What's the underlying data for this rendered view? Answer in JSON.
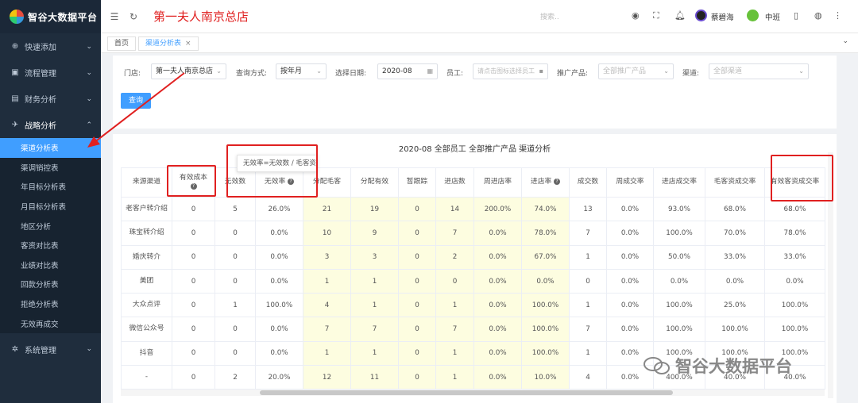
{
  "app": {
    "name": "智谷大数据平台"
  },
  "sidebar": {
    "items": [
      {
        "label": "快速添加",
        "icon": "plus-circle-icon"
      },
      {
        "label": "流程管理",
        "icon": "camera-icon"
      },
      {
        "label": "财务分析",
        "icon": "chart-icon"
      },
      {
        "label": "战略分析",
        "icon": "plane-icon"
      }
    ],
    "submenu": [
      {
        "label": "渠道分析表",
        "active": true
      },
      {
        "label": "渠调销控表"
      },
      {
        "label": "年目标分析表"
      },
      {
        "label": "月目标分析表"
      },
      {
        "label": "地区分析"
      },
      {
        "label": "客资对比表"
      },
      {
        "label": "业绩对比表"
      },
      {
        "label": "回款分析表"
      },
      {
        "label": "拒绝分析表"
      },
      {
        "label": "无效再成交"
      }
    ],
    "system": {
      "label": "系统管理",
      "icon": "gear-icon"
    }
  },
  "header": {
    "store_title": "第一夫人南京总店",
    "search_placeholder": "搜索..",
    "user1": "蔡碧海",
    "user2": "中班"
  },
  "tabs": [
    {
      "label": "首页"
    },
    {
      "label": "渠道分析表",
      "active": true,
      "close": "×"
    }
  ],
  "filter": {
    "store_label": "门店:",
    "store_value": "第一夫人南京总店",
    "query_mode_label": "查询方式:",
    "query_mode_value": "按年月",
    "date_label": "选择日期:",
    "date_value": "2020-08",
    "staff_label": "员工:",
    "staff_placeholder": "请点击图标选择员工",
    "product_label": "推广产品:",
    "product_placeholder": "全部推广产品",
    "channel_label": "渠道:",
    "channel_placeholder": "全部渠道",
    "query_button": "查询"
  },
  "table": {
    "title": "2020-08 全部员工 全部推广产品 渠道分析",
    "tooltip": "无效率=无效数 / 毛客资",
    "columns": [
      "来源渠道",
      "有效成本",
      "无效数",
      "无效率",
      "分配毛客",
      "分配有效",
      "暂跟踪",
      "进店数",
      "周进店率",
      "进店率",
      "成交数",
      "周成交率",
      "进店成交率",
      "毛客资成交率",
      "有效客资成交率"
    ],
    "rows": [
      [
        "老客户转介绍",
        "0",
        "5",
        "26.0%",
        "21",
        "19",
        "0",
        "14",
        "200.0%",
        "74.0%",
        "13",
        "0.0%",
        "93.0%",
        "68.0%",
        "68.0%"
      ],
      [
        "珠宝转介绍",
        "0",
        "0",
        "0.0%",
        "10",
        "9",
        "0",
        "7",
        "0.0%",
        "78.0%",
        "7",
        "0.0%",
        "100.0%",
        "70.0%",
        "78.0%"
      ],
      [
        "婚庆转介",
        "0",
        "0",
        "0.0%",
        "3",
        "3",
        "0",
        "2",
        "0.0%",
        "67.0%",
        "1",
        "0.0%",
        "50.0%",
        "33.0%",
        "33.0%"
      ],
      [
        "美团",
        "0",
        "0",
        "0.0%",
        "1",
        "1",
        "0",
        "0",
        "0.0%",
        "0.0%",
        "0",
        "0.0%",
        "0.0%",
        "0.0%",
        "0.0%"
      ],
      [
        "大众点评",
        "0",
        "1",
        "100.0%",
        "4",
        "1",
        "0",
        "1",
        "0.0%",
        "100.0%",
        "1",
        "0.0%",
        "100.0%",
        "25.0%",
        "100.0%"
      ],
      [
        "微信公众号",
        "0",
        "0",
        "0.0%",
        "7",
        "7",
        "0",
        "7",
        "0.0%",
        "100.0%",
        "7",
        "0.0%",
        "100.0%",
        "100.0%",
        "100.0%"
      ],
      [
        "抖音",
        "0",
        "0",
        "0.0%",
        "1",
        "1",
        "0",
        "1",
        "0.0%",
        "100.0%",
        "1",
        "0.0%",
        "100.0%",
        "100.0%",
        "100.0%"
      ],
      [
        "-",
        "0",
        "2",
        "20.0%",
        "12",
        "11",
        "0",
        "1",
        "0.0%",
        "10.0%",
        "4",
        "0.0%",
        "400.0%",
        "40.0%",
        "40.0%"
      ]
    ]
  },
  "watermark": "智谷大数据平台",
  "colors": {
    "sidebar_bg": "#1f2d3d",
    "accent": "#409eff",
    "annotation": "#e02020",
    "highlight": "#fdfde0"
  }
}
